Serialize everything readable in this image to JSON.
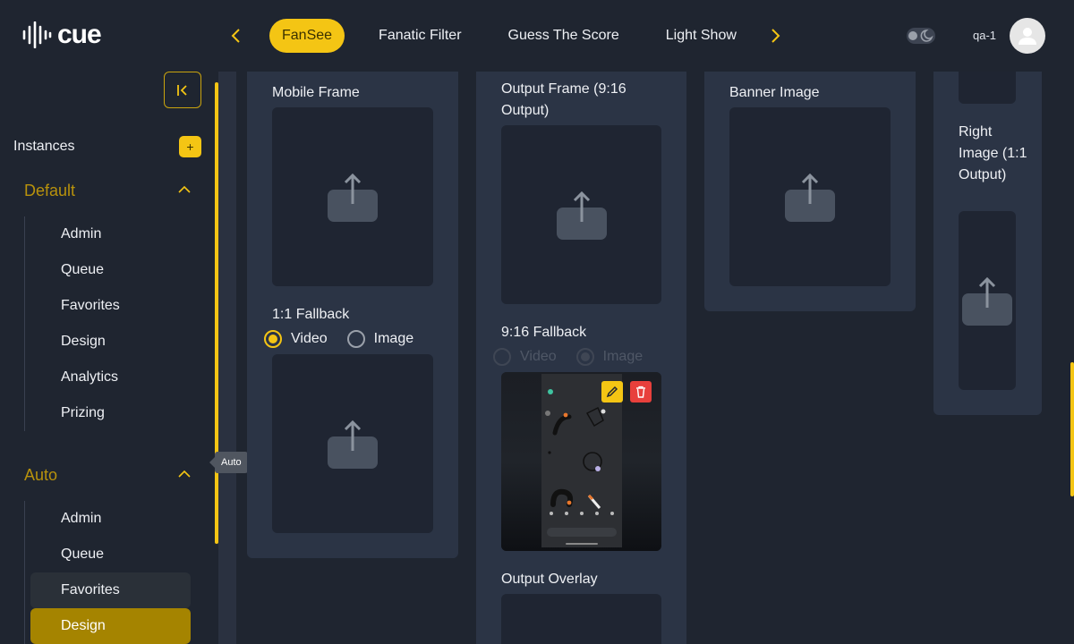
{
  "brand": {
    "logo_text": "cue"
  },
  "header": {
    "tabs": [
      {
        "label": "FanSee",
        "active": true
      },
      {
        "label": "Fanatic Filter",
        "active": false
      },
      {
        "label": "Guess The Score",
        "active": false
      },
      {
        "label": "Light Show",
        "active": false
      }
    ],
    "user_name": "qa-1"
  },
  "sidebar": {
    "instances_label": "Instances",
    "add_label": "+",
    "tooltip": "Auto",
    "groups": [
      {
        "title": "Default",
        "items": [
          "Admin",
          "Queue",
          "Favorites",
          "Design",
          "Analytics",
          "Prizing"
        ]
      },
      {
        "title": "Auto",
        "items": [
          "Admin",
          "Queue",
          "Favorites",
          "Design"
        ]
      }
    ],
    "active_item": "Auto / Design",
    "hover_item": "Auto / Favorites"
  },
  "main": {
    "mobile_frame": "Mobile Frame",
    "fallback_1x1": "1:1 Fallback",
    "output_frame": "Output Frame (9:16 Output)",
    "fallback_9x16": "9:16 Fallback",
    "output_overlay": "Output Overlay",
    "banner_image": "Banner Image",
    "right_image": "Right Image (1:1 Output)",
    "radio_video": "Video",
    "radio_image": "Image"
  },
  "colors": {
    "accent": "#f4c514",
    "background": "#1f2530",
    "card": "#2b3445",
    "delete": "#e8403c"
  }
}
